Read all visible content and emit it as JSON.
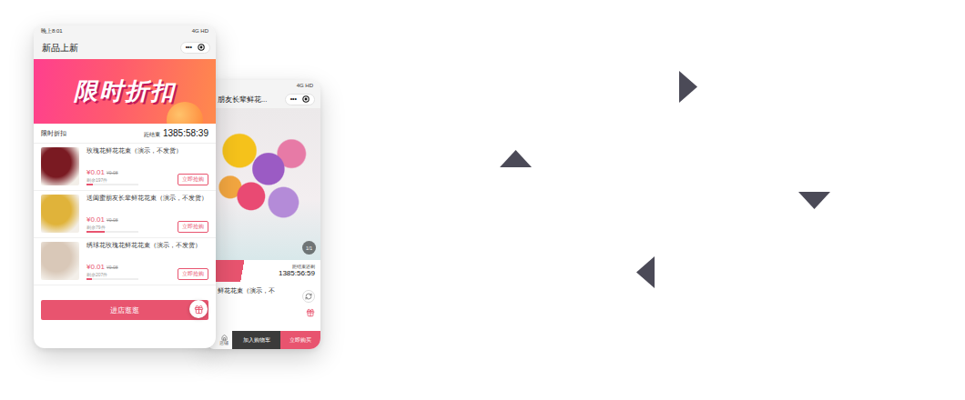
{
  "list_page": {
    "status_time": "晚上8:01",
    "status_network": "4G HD",
    "title": "新品上新",
    "menu_glyph": "•••",
    "banner_title": "限时折扣",
    "section_title": "限时折扣",
    "countdown_label": "距结束",
    "countdown": "1385:58:39",
    "items": [
      {
        "name": "玫瑰花鲜花花束（演示，不发货）",
        "price": "¥0.01",
        "original_price": "¥0.08",
        "stock": "剩余197件",
        "level": 0.12,
        "button": "立即抢购",
        "color": "#7a1a22"
      },
      {
        "name": "送闺蜜朋友长辈鲜花花束（演示，不发货）",
        "price": "¥0.01",
        "original_price": "¥0.08",
        "stock": "剩余79件",
        "level": 0.35,
        "button": "立即抢购",
        "color": "#e0b33a"
      },
      {
        "name": "绣球花玫瑰花鲜花花束（演示，不发货）",
        "price": "¥0.01",
        "original_price": "¥0.08",
        "stock": "剩余207件",
        "level": 0.1,
        "button": "立即抢购",
        "color": "#d9c8b8"
      }
    ],
    "enter_button": "进店逛逛"
  },
  "detail_page": {
    "status_network": "4G HD",
    "title": "朋友长辈鲜花...",
    "menu_glyph": "•••",
    "image_counter": "1/1",
    "countdown_label": "距结束还剩",
    "countdown": "1385:56:59",
    "product_name": "鲜花花束（演示，不",
    "tabbar": [
      {
        "label": "店铺",
        "kind": "home"
      },
      {
        "label": "加入购物车",
        "kind": "cart"
      },
      {
        "label": "立即购买",
        "kind": "buy"
      }
    ]
  },
  "arrows": [
    {
      "kind": "right"
    },
    {
      "kind": "up"
    },
    {
      "kind": "down"
    },
    {
      "kind": "left"
    }
  ]
}
